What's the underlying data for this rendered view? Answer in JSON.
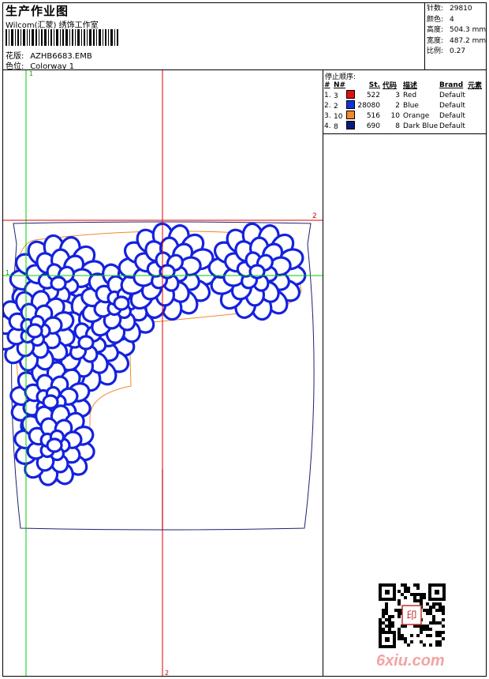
{
  "header": {
    "title": "生产作业图",
    "company": "Wilcom(汇蒙) 绣饰工作室",
    "design_label": "花版:",
    "design_value": "AZHB6683.EMB",
    "color_label": "色位:",
    "color_value": "Colorway 1"
  },
  "stats": [
    {
      "key": "针数:",
      "value": "29810"
    },
    {
      "key": "颜色:",
      "value": "4"
    },
    {
      "key": "高度:",
      "value": "504.3 mm"
    },
    {
      "key": "宽度:",
      "value": "487.2 mm"
    },
    {
      "key": "比例:",
      "value": "0.27"
    }
  ],
  "stop_sequence": {
    "title": "停止顺序:",
    "headers": [
      "#",
      "N#",
      "St.",
      "代码",
      "描述",
      "Brand",
      "元素"
    ],
    "rows": [
      {
        "index": "1.",
        "needle": "3",
        "swatch": "#e01010",
        "stitches": "522",
        "code": "3",
        "desc": "Red",
        "brand": "Default"
      },
      {
        "index": "2.",
        "needle": "2",
        "swatch": "#1432d8",
        "stitches": "28080",
        "code": "2",
        "desc": "Blue",
        "brand": "Default"
      },
      {
        "index": "3.",
        "needle": "10",
        "swatch": "#f08a2c",
        "stitches": "516",
        "code": "10",
        "desc": "Orange",
        "brand": "Default"
      },
      {
        "index": "4.",
        "needle": "8",
        "swatch": "#0b1a7a",
        "stitches": "690",
        "code": "8",
        "desc": "Dark Blue",
        "brand": "Default"
      }
    ]
  },
  "guides": {
    "green_v_label": "1",
    "green_h_label": "1",
    "red_h_label": "2",
    "red_v_label": "2"
  },
  "watermark": {
    "site": "6xiu.com",
    "seal": "印"
  },
  "colors": {
    "thread_blue": "#1422dd",
    "outline_orange": "#f08a2c",
    "garment_navy": "#1a2270",
    "guide_green": "#00cc00",
    "guide_red": "#e00000"
  }
}
